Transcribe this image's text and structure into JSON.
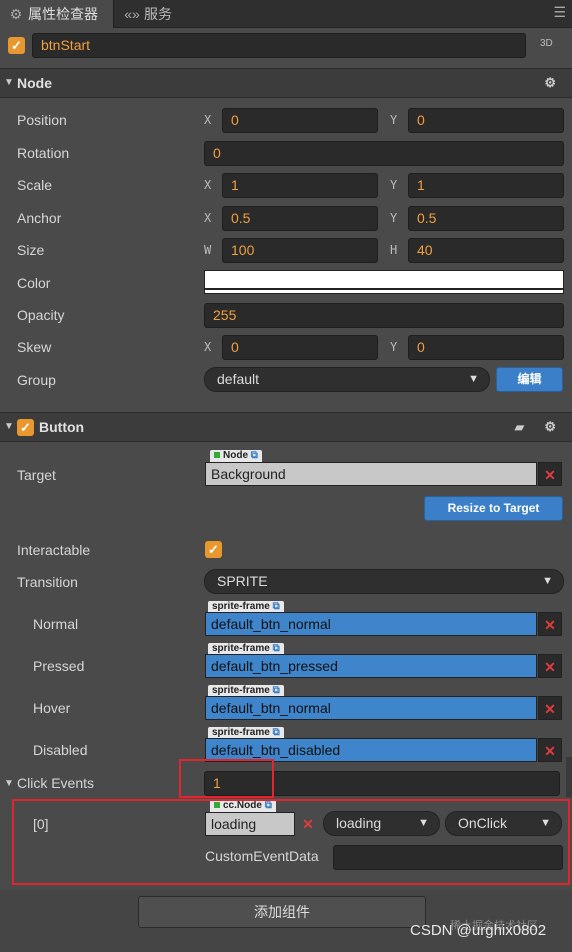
{
  "tabs": [
    {
      "label": "属性检查器",
      "icon": "gear-icon"
    },
    {
      "label": "服务",
      "icon": "service-icon"
    }
  ],
  "node_header": {
    "name": "btnStart",
    "mode": "3D"
  },
  "node_section": {
    "title": "Node",
    "position": {
      "label": "Position",
      "x": "0",
      "y": "0"
    },
    "rotation": {
      "label": "Rotation",
      "value": "0"
    },
    "scale": {
      "label": "Scale",
      "x": "1",
      "y": "1"
    },
    "anchor": {
      "label": "Anchor",
      "x": "0.5",
      "y": "0.5"
    },
    "size": {
      "label": "Size",
      "w": "100",
      "h": "40"
    },
    "color": {
      "label": "Color",
      "value": "#ffffff"
    },
    "opacity": {
      "label": "Opacity",
      "value": "255"
    },
    "skew": {
      "label": "Skew",
      "x": "0",
      "y": "0"
    },
    "group": {
      "label": "Group",
      "value": "default",
      "edit": "编辑"
    },
    "axis": {
      "x": "X",
      "y": "Y",
      "w": "W",
      "h": "H"
    }
  },
  "button_section": {
    "title": "Button",
    "target": {
      "label": "Target",
      "tag": "Node",
      "value": "Background",
      "resize": "Resize to Target"
    },
    "interactable": {
      "label": "Interactable"
    },
    "transition": {
      "label": "Transition",
      "value": "SPRITE"
    },
    "normal": {
      "label": "Normal",
      "tag": "sprite-frame",
      "value": "default_btn_normal"
    },
    "pressed": {
      "label": "Pressed",
      "tag": "sprite-frame",
      "value": "default_btn_pressed"
    },
    "hover": {
      "label": "Hover",
      "tag": "sprite-frame",
      "value": "default_btn_normal"
    },
    "disabled": {
      "label": "Disabled",
      "tag": "sprite-frame",
      "value": "default_btn_disabled"
    },
    "click_events": {
      "label": "Click Events",
      "count": "1"
    },
    "event0": {
      "index": "[0]",
      "tag": "cc.Node",
      "node": "loading",
      "component": "loading",
      "handler": "OnClick",
      "custom_label": "CustomEventData",
      "custom_value": ""
    }
  },
  "add_component": "添加组件",
  "watermark": "CSDN @urghix0802",
  "watermark_faint": "稀土掘金技术社区",
  "colors": {
    "accent": "#e8982f",
    "blue": "#3f85cc",
    "red_box": "#e0262e"
  }
}
